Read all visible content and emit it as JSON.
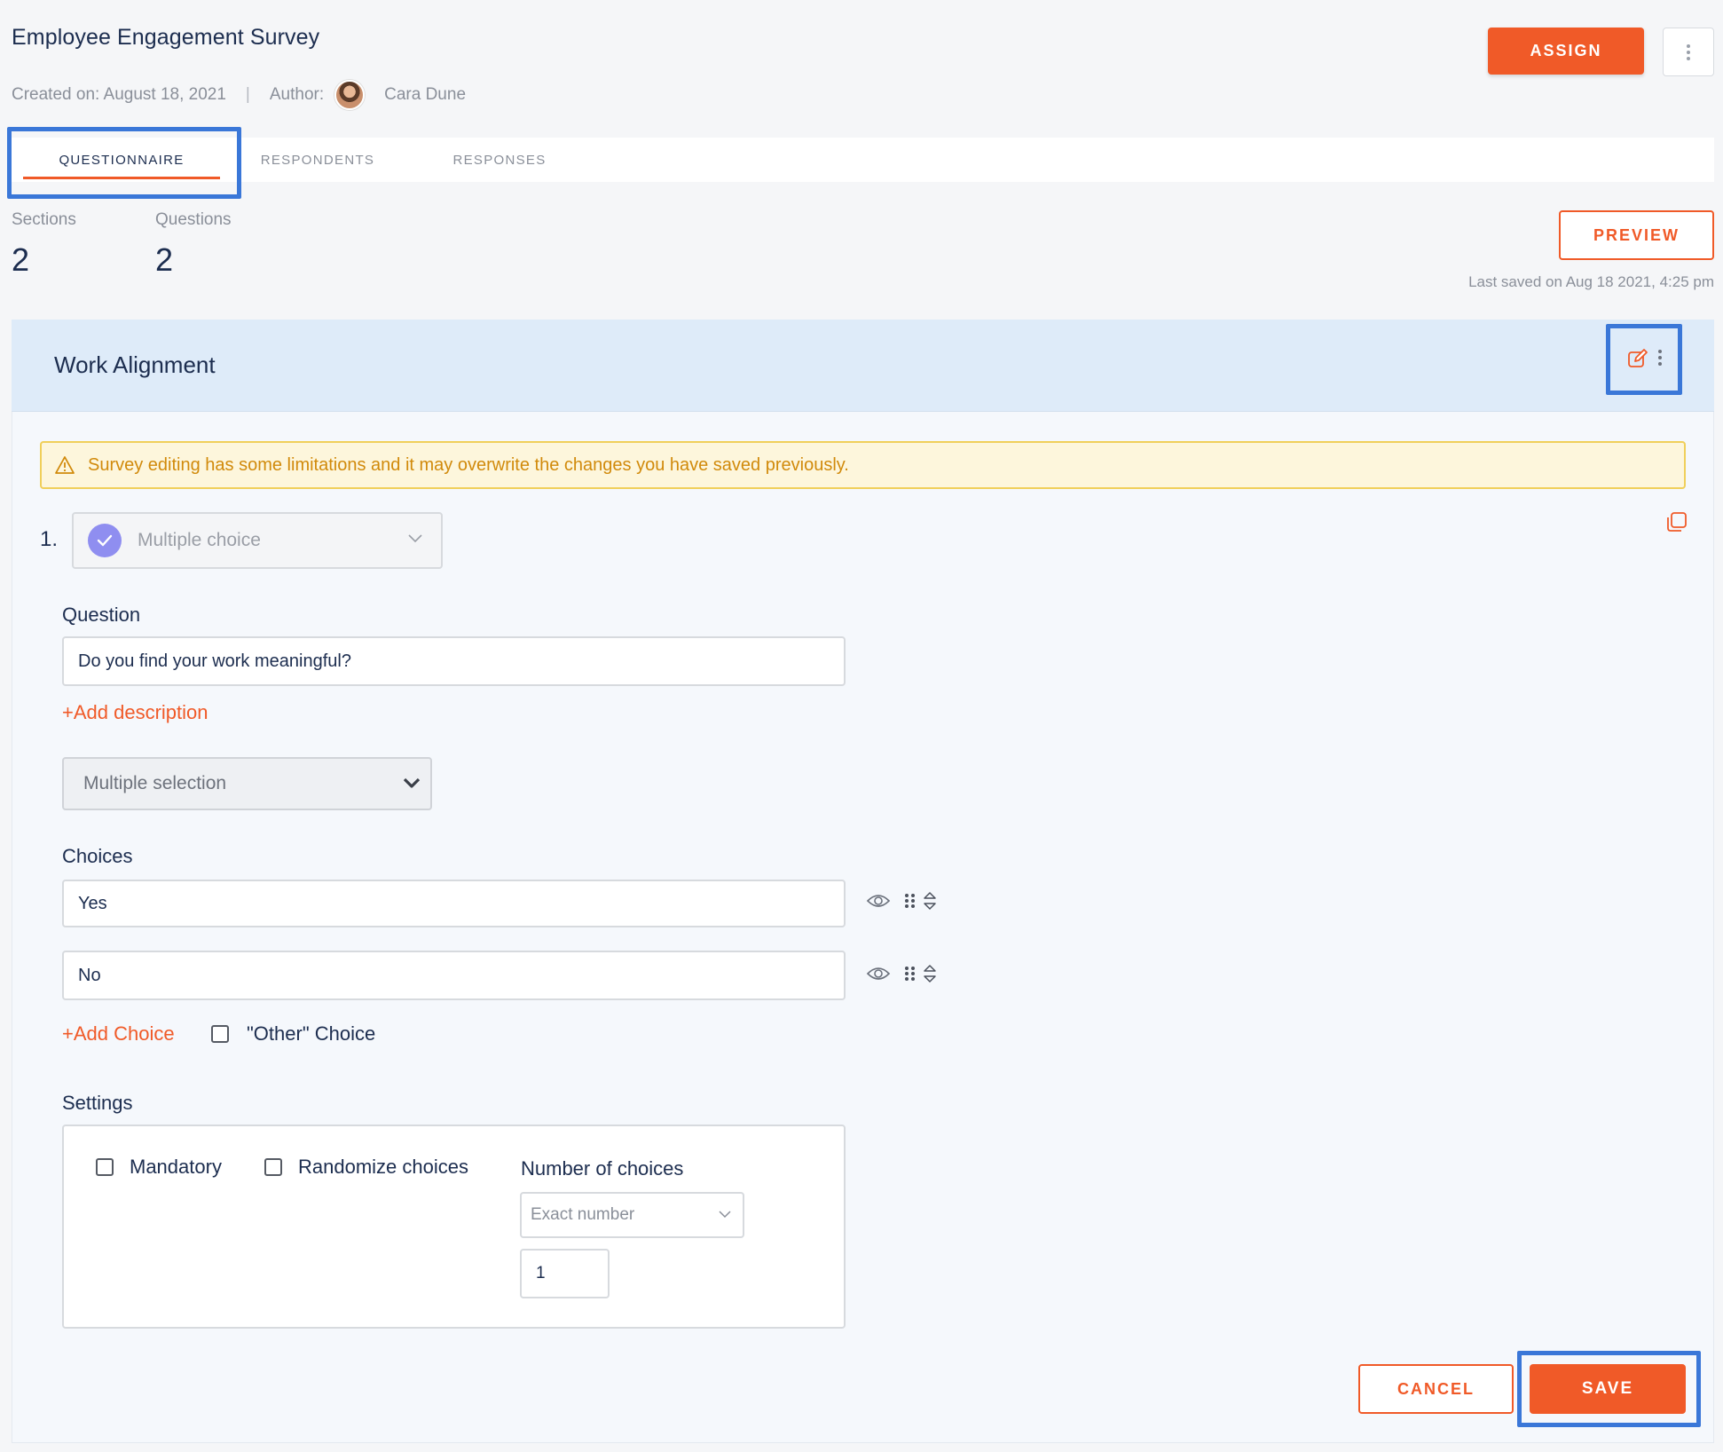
{
  "header": {
    "title": "Employee Engagement Survey",
    "created_label": "Created on: August 18, 2021",
    "separator": "|",
    "author_label": "Author:",
    "author_name": "Cara Dune",
    "assign_label": "ASSIGN",
    "more_icon": "kebab-vertical-icon"
  },
  "tabs": [
    {
      "label": "QUESTIONNAIRE",
      "active": true
    },
    {
      "label": "RESPONDENTS",
      "active": false
    },
    {
      "label": "RESPONSES",
      "active": false
    }
  ],
  "stats": {
    "sections_label": "Sections",
    "sections_value": "2",
    "questions_label": "Questions",
    "questions_value": "2"
  },
  "preview_label": "PREVIEW",
  "last_saved": "Last saved on Aug 18 2021, 4:25 pm",
  "section": {
    "title": "Work Alignment",
    "warning": "Survey editing has some limitations and it may overwrite the changes you have saved previously."
  },
  "question": {
    "number": "1.",
    "type": "Multiple choice",
    "question_label": "Question",
    "question_value": "Do you find your work meaningful?",
    "add_description": "+Add description",
    "selection_mode": "Multiple selection",
    "choices_label": "Choices",
    "choices": [
      "Yes",
      "No"
    ],
    "add_choice": "+Add Choice",
    "other_choice": "\"Other\" Choice",
    "settings_label": "Settings",
    "mandatory": "Mandatory",
    "randomize": "Randomize choices",
    "num_choices_label": "Number of choices",
    "num_choices_mode": "Exact number",
    "num_choices_value": "1"
  },
  "actions": {
    "cancel": "CANCEL",
    "save": "SAVE"
  },
  "colors": {
    "accent": "#f05a28",
    "highlight": "#3a77d8",
    "section_header": "#deebf9",
    "warning_bg": "#fdf6dc",
    "warning_text": "#d18a0b"
  }
}
